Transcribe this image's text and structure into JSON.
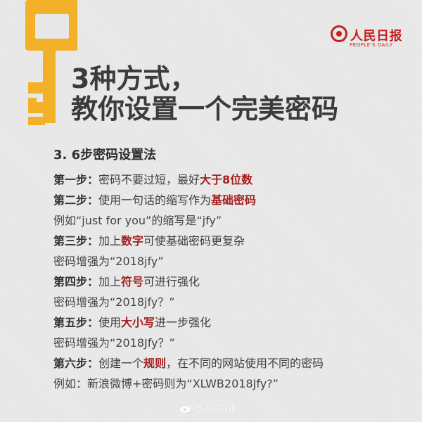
{
  "brand": {
    "name": "人民日报",
    "subtitle": "PEOPLE'S DAILY"
  },
  "title": {
    "line1": "3种方式，",
    "line2": "教你设置一个完美密码"
  },
  "section": {
    "title": "3. 6步密码设置法"
  },
  "steps": [
    {
      "label": "第一步：",
      "before": "密码不要过短，最好",
      "highlight": "大于8位数",
      "after": ""
    },
    {
      "label": "第二步：",
      "before": "使用一句话的缩写作为",
      "highlight": "基础密码",
      "after": ""
    },
    {
      "text": "例如“just for you”的缩写是“jfy”"
    },
    {
      "label": "第三步：",
      "before": "加上",
      "highlight": "数字",
      "after": "可使基础密码更复杂"
    },
    {
      "text": "密码增强为“2018jfy”"
    },
    {
      "label": "第四步：",
      "before": "加上",
      "highlight": "符号",
      "after": "可进行强化"
    },
    {
      "text": "密码增强为“2018jfy？”"
    },
    {
      "label": "第五步：",
      "before": "使用",
      "highlight": "大小写",
      "after": "进一步强化"
    },
    {
      "text": "密码增强为“2018Jfy？”"
    },
    {
      "label": "第六步：",
      "before": "创建一个",
      "highlight": "规则",
      "after": "，在不同的网站使用不同的密码"
    },
    {
      "text": "例如：新浪微博+密码则为“XLWB2018Jfy?”"
    }
  ],
  "watermark": {
    "text": "@人民日报"
  },
  "colors": {
    "background": "#e7e7e7",
    "title": "#3b3b3b",
    "accent": "#a41f1f",
    "key": "#f3b12a",
    "brand": "#c91f1f"
  },
  "icons": {
    "key": "key-icon",
    "brand": "brand-logo-icon",
    "watermark": "weibo-watermark-icon"
  }
}
